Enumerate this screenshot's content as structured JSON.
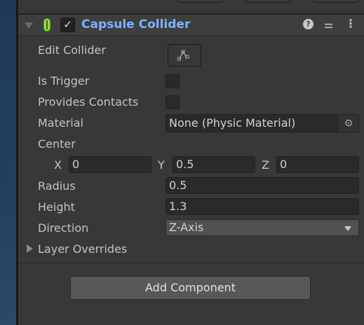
{
  "component": {
    "title": "Capsule Collider",
    "enabled": true,
    "icon": "capsule-collider-icon",
    "help_icon": "help-icon",
    "presets_icon": "presets-icon",
    "menu_icon": "kebab-menu-icon",
    "accent": "#7cb3ff"
  },
  "fields": {
    "edit_collider": {
      "label": "Edit Collider",
      "icon": "edit-collider-icon"
    },
    "is_trigger": {
      "label": "Is Trigger",
      "checked": false
    },
    "provides_contacts": {
      "label": "Provides Contacts",
      "checked": false
    },
    "material": {
      "label": "Material",
      "value": "None (Physic Material)",
      "picker_icon": "object-picker-icon"
    },
    "center": {
      "label": "Center",
      "x_label": "X",
      "x": "0",
      "y_label": "Y",
      "y": "0.5",
      "z_label": "Z",
      "z": "0"
    },
    "radius": {
      "label": "Radius",
      "value": "0.5"
    },
    "height": {
      "label": "Height",
      "value": "1.3"
    },
    "direction": {
      "label": "Direction",
      "value": "Z-Axis"
    },
    "layer_overrides": {
      "label": "Layer Overrides",
      "expanded": false
    }
  },
  "add_component": {
    "label": "Add Component"
  }
}
